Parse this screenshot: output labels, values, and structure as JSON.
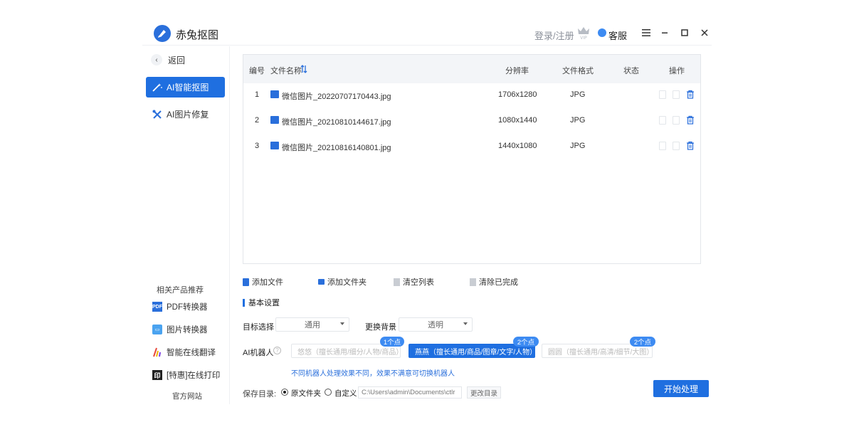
{
  "titlebar": {
    "app_title": "赤兔抠图",
    "login_label": "登录/注册",
    "vip_icon": "vip-crown-icon",
    "support_label": "客服",
    "menu_icon": "hamburger-icon",
    "minimize_icon": "minimize-icon",
    "maximize_icon": "maximize-icon",
    "close_icon": "close-icon"
  },
  "sidebar": {
    "back_label": "返回",
    "nav": [
      {
        "label": "AI智能抠图",
        "active": true,
        "icon": "magic-wand-icon"
      },
      {
        "label": "AI图片修复",
        "active": false,
        "icon": "tools-icon"
      }
    ],
    "related_title": "相关产品推荐",
    "products": [
      {
        "label": "PDF转换器",
        "icon": "pdf-icon"
      },
      {
        "label": "图片转换器",
        "icon": "image-converter-icon"
      },
      {
        "label": "智能在线翻译",
        "icon": "translate-icon"
      },
      {
        "label": "[特惠]在线打印",
        "icon": "print-icon"
      }
    ],
    "official_label": "官方网站"
  },
  "table": {
    "headers": {
      "index": "编号",
      "filename": "文件名称",
      "resolution": "分辨率",
      "format": "文件格式",
      "status": "状态",
      "actions": "操作"
    },
    "rows": [
      {
        "index": "1",
        "filename": "微信图片_20220707170443.jpg",
        "resolution": "1706x1280",
        "format": "JPG",
        "status": ""
      },
      {
        "index": "2",
        "filename": "微信图片_20210810144617.jpg",
        "resolution": "1080x1440",
        "format": "JPG",
        "status": ""
      },
      {
        "index": "3",
        "filename": "微信图片_20210816140801.jpg",
        "resolution": "1440x1080",
        "format": "JPG",
        "status": ""
      }
    ]
  },
  "actions": {
    "add_file": "添加文件",
    "add_folder": "添加文件夹",
    "clear_list": "清空列表",
    "clear_done": "清除已完成"
  },
  "settings": {
    "section_title": "基本设置",
    "target_label": "目标选择",
    "target_value": "通用",
    "bg_label": "更换背景",
    "bg_value": "透明",
    "robot_label": "AI机器人",
    "robots": [
      {
        "label": "悠悠（擅长通用/细分/人物/商品）",
        "badge": "1个点",
        "active": false
      },
      {
        "label": "燕燕（擅长通用/商品/图章/文字/人物）",
        "badge": "2个点",
        "active": true
      },
      {
        "label": "圆圆（擅长通用/高清/细节/大图）",
        "badge": "2个点",
        "active": false
      }
    ],
    "hint": "不同机器人处理效果不同，效果不满意可切换机器人",
    "save_label": "保存目录:",
    "save_original": "原文件夹",
    "save_custom": "自定义",
    "save_path": "C:\\Users\\admin\\Documents\\ctlr",
    "change_dir": "更改目录",
    "start_button": "开始处理"
  },
  "colors": {
    "accent": "#1f6fe0",
    "badge": "#3d8bf2"
  }
}
